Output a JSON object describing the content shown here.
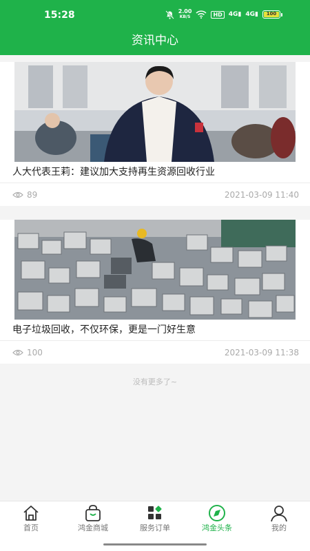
{
  "status": {
    "time": "15:28",
    "net_speed_top": "2.00",
    "net_speed_unit": "KB/S",
    "hd": "HD",
    "sig1": "4G",
    "sig2": "4G",
    "battery": "100"
  },
  "header": {
    "title": "资讯中心"
  },
  "articles": [
    {
      "title": "人大代表王莉：建议加大支持再生资源回收行业",
      "views": "89",
      "date": "2021-03-09 11:40"
    },
    {
      "title": "电子垃圾回收，不仅环保，更是一门好生意",
      "views": "100",
      "date": "2021-03-09 11:38"
    }
  ],
  "footer_note": "没有更多了~",
  "tabbar": {
    "items": [
      {
        "label": "首页",
        "icon": "home-icon"
      },
      {
        "label": "鸿金商城",
        "icon": "shopping-bag-icon"
      },
      {
        "label": "服务订单",
        "icon": "grid-icon"
      },
      {
        "label": "鸿金头条",
        "icon": "compass-icon"
      },
      {
        "label": "我的",
        "icon": "user-icon"
      }
    ],
    "active_index": 3
  },
  "colors": {
    "brand": "#1fb24a",
    "muted": "#aaaaaa"
  }
}
